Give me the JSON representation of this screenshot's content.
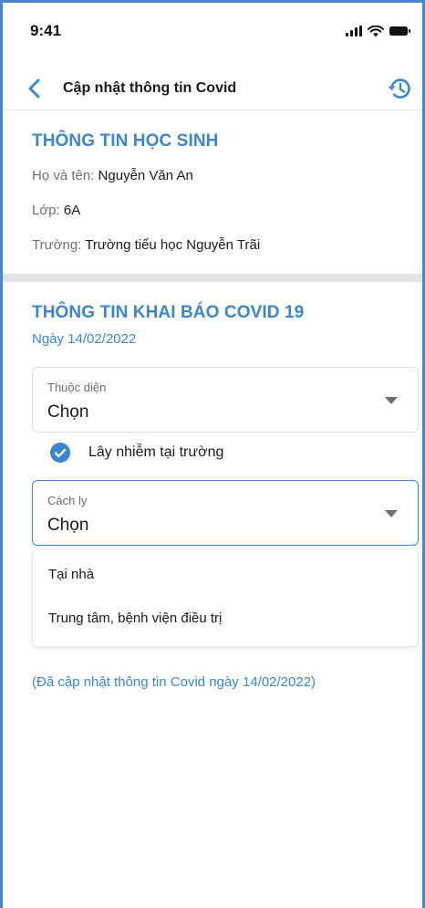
{
  "status_bar": {
    "time": "9:41",
    "icons": [
      "signal-icon",
      "wifi-icon",
      "battery-icon"
    ]
  },
  "header": {
    "title": "Cập nhật thông tin Covid",
    "back_icon": "chevron-left-icon",
    "history_icon": "history-icon"
  },
  "student_info": {
    "title": "THÔNG TIN HỌC SINH",
    "name_label": "Họ và tên:",
    "name_value": "Nguyễn Văn An",
    "class_label": "Lớp:",
    "class_value": "6A",
    "school_label": "Trường:",
    "school_value": "Trường tiểu học Nguyễn Trãi"
  },
  "covid_form": {
    "title": "THÔNG TIN KHAI BÁO COVID 19",
    "date": "Ngày 14/02/2022",
    "category_select": {
      "label": "Thuộc diện",
      "value": "Chọn"
    },
    "infected_at_school": {
      "label": "Lây nhiễm tại trường",
      "checked": true
    },
    "quarantine_select": {
      "label": "Cách ly",
      "value": "Chọn"
    },
    "quarantine_options": [
      "Tại nhà",
      "Trung tâm, bệnh viện điều trị"
    ],
    "update_note": "(Đã cập nhật thông tin Covid ngày 14/02/2022)"
  },
  "colors": {
    "accent": "#3a86d0",
    "frame": "#4a86d0",
    "divider": "#e4e4e4"
  }
}
